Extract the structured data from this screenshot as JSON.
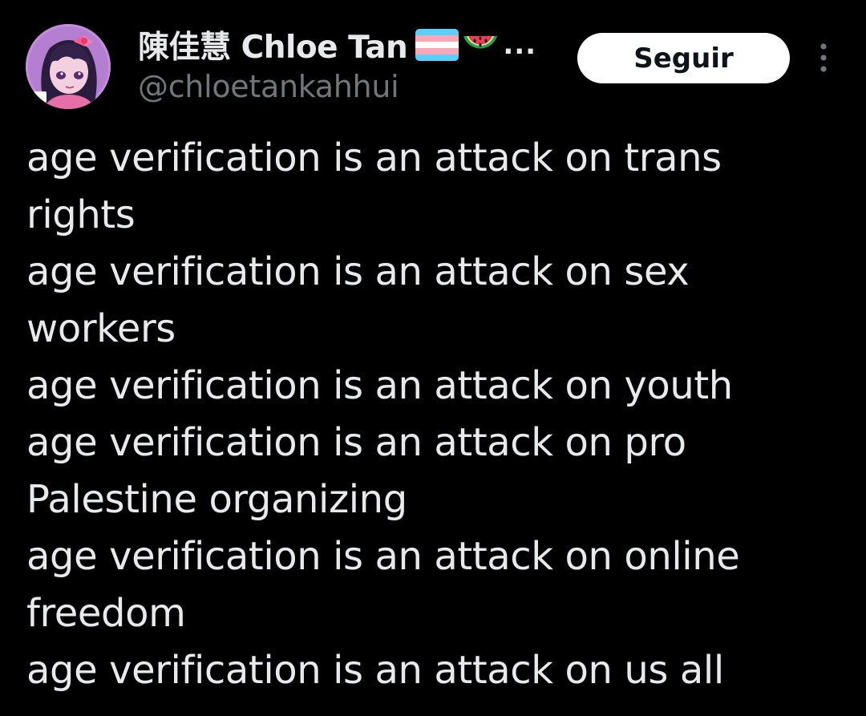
{
  "author": {
    "display_name": "陳佳慧 Chloe Tan",
    "name_emojis": [
      "transgender-flag-icon",
      "watermelon-icon"
    ],
    "name_truncation": "...",
    "handle": "@chloetankahhui"
  },
  "actions": {
    "follow_label": "Seguir",
    "more_icon": "more-vertical-icon"
  },
  "tweet": {
    "lines": [
      "age verification is an attack on trans",
      "rights",
      "age verification is an attack on sex",
      "workers",
      "age verification is an attack on youth",
      "age verification is an attack on pro",
      "Palestine organizing",
      "age verification is an attack on online",
      "freedom",
      "age verification is an attack on us all"
    ]
  },
  "colors": {
    "background": "#000000",
    "primary_text": "#e7e9ea",
    "secondary_text": "#71767b",
    "follow_button_bg": "#ffffff",
    "follow_button_text": "#0f1419",
    "trans_flag_blue": "#5bcefa",
    "trans_flag_pink": "#f5a9b8",
    "trans_flag_white": "#ffffff"
  }
}
